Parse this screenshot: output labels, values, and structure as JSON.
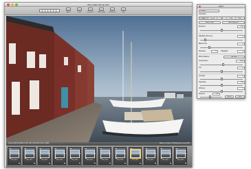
{
  "window": {
    "title": "IMG_5460.CR2 @ 23%",
    "traffic_lights": [
      "#e15a4e",
      "#e8b33b",
      "#5fbf44"
    ]
  },
  "toolbar": {
    "mode_buttons": [
      "grid-icon",
      "list-icon",
      "single-icon",
      "compare-icon",
      "zoom-icon",
      "crop-icon",
      "brush-icon"
    ],
    "buttons": [
      {
        "label": "Adjust",
        "icon": "adjust-icon"
      },
      {
        "label": "Loupe",
        "icon": "loupe-icon"
      },
      {
        "label": "Rotate Left",
        "icon": "rotate-left-icon"
      },
      {
        "label": "Rotate Right",
        "icon": "rotate-right-icon"
      },
      {
        "label": "Full Screen",
        "icon": "fullscreen-icon"
      },
      {
        "label": "Info",
        "icon": "info-icon"
      }
    ]
  },
  "infobar": {
    "left": "Canon EOS 5D Mark II  ISO 100  1/125 f/8.0  24mm  RAW",
    "right": "Master Version  24 MB  Aperture Fast  45%"
  },
  "filmstrip": {
    "frames": [
      "IMG_5452",
      "IMG_5453",
      "IMG_5454",
      "IMG_5455",
      "IMG_5456",
      "IMG_5457",
      "IMG_5458",
      "IMG_5459",
      "IMG_5460",
      "IMG_5461",
      "IMG_5462",
      "IMG_5463"
    ],
    "selected_index": 8
  },
  "panel": {
    "title": "Adjust",
    "close_icon": "close-icon",
    "preset_label": "Custom",
    "histogram_label": "Histogram",
    "tabs": [
      "Edit",
      "Levels",
      "Adj",
      "Color",
      "Meta"
    ],
    "auto_levels_label": "Auto Levels",
    "auto_exposure_label": "Auto Exposure",
    "exposure_label": "Exposure",
    "exposure_value": "0.00",
    "exposure_level": 0.5,
    "recovery_label": "Highlight Recovery",
    "recovery_value": "0",
    "recovery_level": 0.1,
    "black_label": "Black Point",
    "black_value": "3",
    "black_level": 0.2,
    "shadows_label": "Shadows",
    "shadows_value": "0",
    "highlights_label": "Highlights",
    "highlights_value": "0",
    "white_balance_label": "White Balance",
    "white_balance_value": "As Shot",
    "temperature_label": "Temperature",
    "temperature_value": "5200",
    "temperature_level": 0.55,
    "tint_label": "Tint",
    "tint_value": "0",
    "tint_level": 0.5,
    "contrast_label": "Contrast",
    "contrast_value": "0",
    "contrast_level": 0.5,
    "saturation_label": "Saturation",
    "saturation_value": "1.00",
    "saturation_level": 0.5,
    "vibrancy_label": "Vibrancy",
    "vibrancy_value": "0",
    "vibrancy_level": 0.5,
    "sharpen_label": "Sharpen",
    "sharpen_value": "0.50",
    "sharpen_level": 0.45,
    "reset_label": "Reset",
    "save_label": "Save"
  }
}
